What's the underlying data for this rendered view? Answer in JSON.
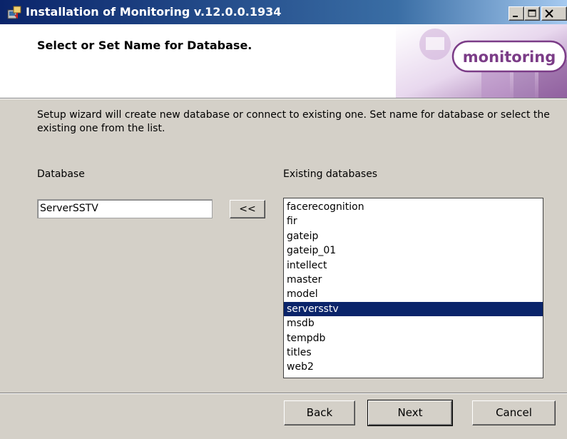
{
  "window": {
    "title": "Installation of Monitoring v.12.0.0.1934"
  },
  "header": {
    "page_title": "Select or Set Name for Database.",
    "logo_text": "monitoring"
  },
  "body": {
    "intro": "Setup wizard will create new database or connect to existing one. Set name for database or select the existing one from the list.",
    "database_label": "Database",
    "database_value": "ServerSSTV",
    "copy_button": "<<",
    "existing_label": "Existing databases",
    "existing_databases": [
      "facerecognition",
      "fir",
      "gateip",
      "gateip_01",
      "intellect",
      "master",
      "model",
      "serversstv",
      "msdb",
      "tempdb",
      "titles",
      "web2"
    ],
    "selected_database": "serversstv"
  },
  "footer": {
    "back": "Back",
    "next": "Next",
    "cancel": "Cancel"
  },
  "colors": {
    "selection": "#0a246a",
    "logo_purple": "#7b3c87",
    "window_face": "#d4d0c8"
  }
}
